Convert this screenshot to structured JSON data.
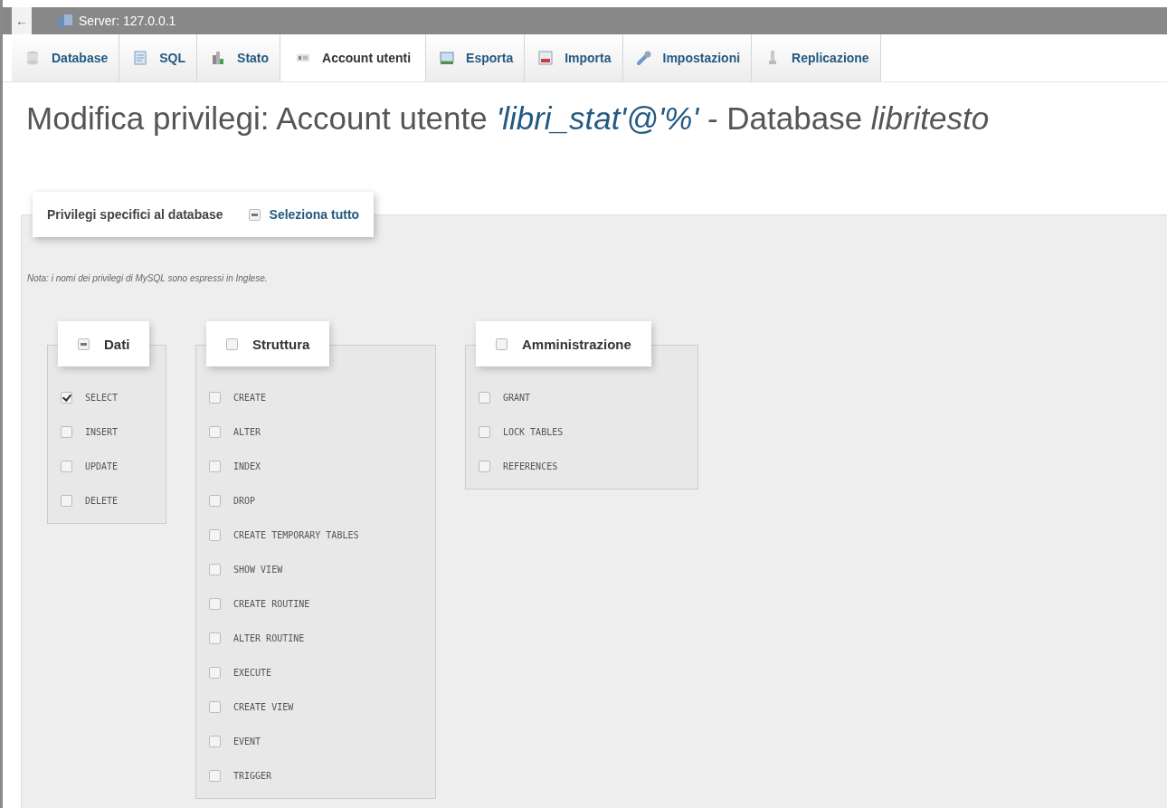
{
  "topbar": {
    "back": "←",
    "server": "Server: 127.0.0.1"
  },
  "tabs": [
    {
      "label": "Database",
      "selected": false
    },
    {
      "label": "SQL",
      "selected": false
    },
    {
      "label": "Stato",
      "selected": false
    },
    {
      "label": "Account utenti",
      "selected": true
    },
    {
      "label": "Esporta",
      "selected": false
    },
    {
      "label": "Importa",
      "selected": false
    },
    {
      "label": "Impostazioni",
      "selected": false
    },
    {
      "label": "Replicazione",
      "selected": false
    }
  ],
  "title": [
    {
      "text": "Modifica privilegi: Account utente ",
      "kind": "plain"
    },
    {
      "text": "'libri_stat'@'%'",
      "kind": "user"
    },
    {
      "text": " - Database ",
      "kind": "plain"
    },
    {
      "text": "libritesto",
      "kind": "db"
    }
  ],
  "fieldset": {
    "legend": "Privilegi specifici al database",
    "select_all": {
      "label": "Seleziona tutto",
      "indeterminate": true
    }
  },
  "note": "Nota: i nomi dei privilegi di MySQL sono espressi in Inglese.",
  "groups": [
    {
      "label": "Dati",
      "indeterminate": true,
      "items": [
        {
          "label": "SELECT",
          "checked": true
        },
        {
          "label": "INSERT",
          "checked": false
        },
        {
          "label": "UPDATE",
          "checked": false
        },
        {
          "label": "DELETE",
          "checked": false
        }
      ]
    },
    {
      "label": "Struttura",
      "indeterminate": false,
      "items": [
        {
          "label": "CREATE",
          "checked": false
        },
        {
          "label": "ALTER",
          "checked": false
        },
        {
          "label": "INDEX",
          "checked": false
        },
        {
          "label": "DROP",
          "checked": false
        },
        {
          "label": "CREATE TEMPORARY TABLES",
          "checked": false
        },
        {
          "label": "SHOW VIEW",
          "checked": false
        },
        {
          "label": "CREATE ROUTINE",
          "checked": false
        },
        {
          "label": "ALTER ROUTINE",
          "checked": false
        },
        {
          "label": "EXECUTE",
          "checked": false
        },
        {
          "label": "CREATE VIEW",
          "checked": false
        },
        {
          "label": "EVENT",
          "checked": false
        },
        {
          "label": "TRIGGER",
          "checked": false
        }
      ]
    },
    {
      "label": "Amministrazione",
      "indeterminate": false,
      "items": [
        {
          "label": "GRANT",
          "checked": false
        },
        {
          "label": "LOCK TABLES",
          "checked": false
        },
        {
          "label": "REFERENCES",
          "checked": false
        }
      ]
    }
  ]
}
